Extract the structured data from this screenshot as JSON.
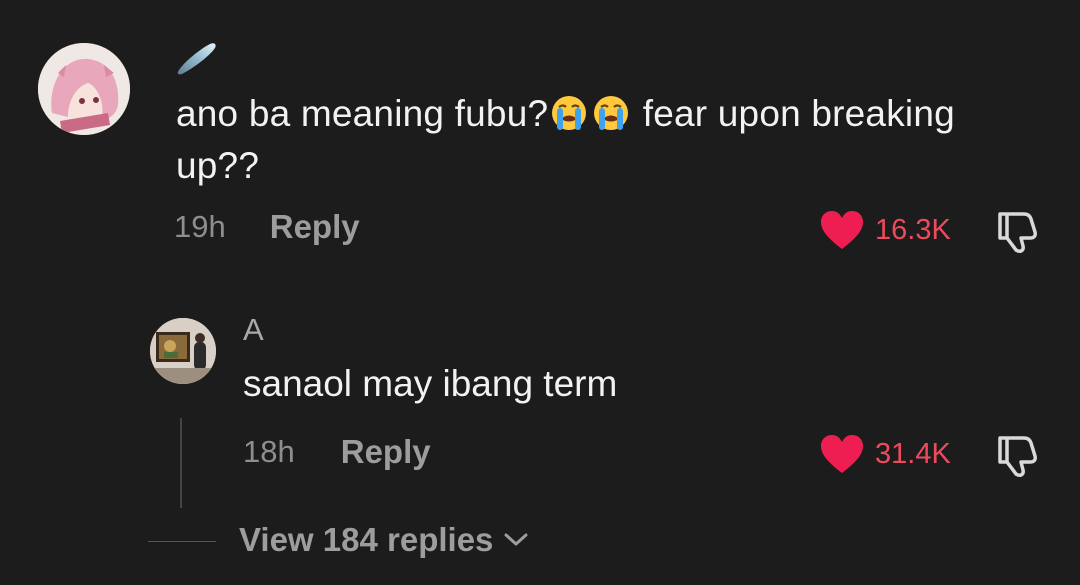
{
  "comments": [
    {
      "text_before": "ano ba meaning fubu?",
      "emojis": [
        "crying-face-emoji",
        "crying-face-emoji"
      ],
      "text_after": " fear upon breaking up??",
      "time": "19h",
      "reply_label": "Reply",
      "likes": "16.3K"
    },
    {
      "username": "A",
      "text": "sanaol may ibang term",
      "time": "18h",
      "reply_label": "Reply",
      "likes": "31.4K"
    }
  ],
  "view_replies": {
    "label": "View 184 replies"
  },
  "colors": {
    "background": "#1c1c1c",
    "like": "#ee4a5d",
    "text": "#f2f2f2",
    "muted": "#9d9d9d"
  }
}
